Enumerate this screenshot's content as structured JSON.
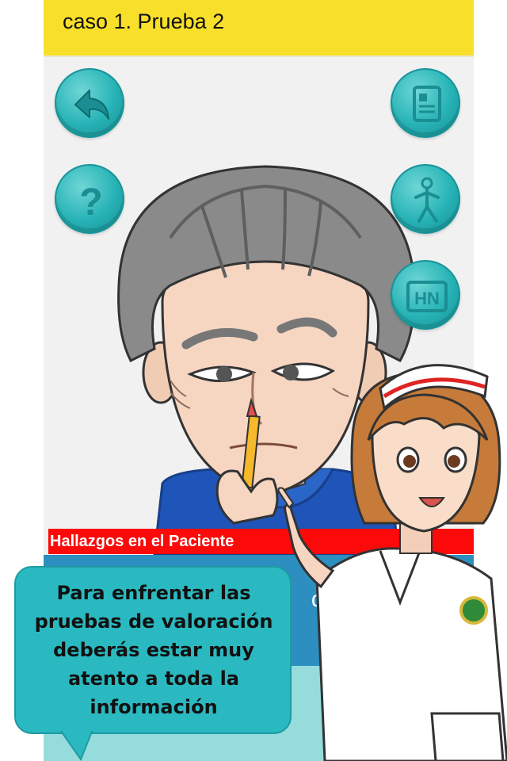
{
  "header": {
    "title": "caso 1. Prueba 2"
  },
  "buttons": {
    "back": "back-arrow-icon",
    "help": "question-mark-icon",
    "document": "document-icon",
    "walk": "walking-person-icon",
    "hn": {
      "icon": "hn-icon",
      "label": "HN"
    }
  },
  "findings": {
    "title": "Hallazgos en el Paciente"
  },
  "partial_text": "de",
  "bubble": {
    "text": "Para enfrentar las pruebas de valoración deberás estar muy atento a toda la información"
  },
  "colors": {
    "header": "#f8df2a",
    "button": "#27b3b6",
    "findings_bar": "#fc0a0a",
    "bubble": "#2bb9c1"
  }
}
